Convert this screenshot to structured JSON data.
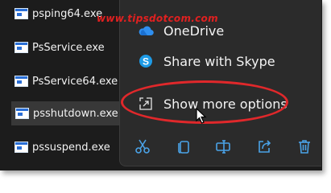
{
  "files": [
    {
      "name": "psping64.exe",
      "selected": false
    },
    {
      "name": "PsService.exe",
      "selected": false
    },
    {
      "name": "PsService64.exe",
      "selected": false
    },
    {
      "name": "psshutdown.exe",
      "selected": true
    },
    {
      "name": "pssuspend.exe",
      "selected": false
    }
  ],
  "watermark": "www.tipsdotcom.com",
  "menu": {
    "items": [
      {
        "label": "OneDrive",
        "icon": "onedrive-icon"
      },
      {
        "label": "Share with Skype",
        "icon": "skype-icon"
      },
      {
        "label": "Show more options",
        "icon": "show-more-options-icon"
      }
    ]
  },
  "toolbar": {
    "buttons": [
      {
        "icon": "cut-icon"
      },
      {
        "icon": "copy-icon"
      },
      {
        "icon": "rename-icon"
      },
      {
        "icon": "share-icon"
      },
      {
        "icon": "delete-icon"
      }
    ]
  },
  "colors": {
    "highlight_ellipse": "#e0282b",
    "accent": "#4aa3e8",
    "menu_background": "#2b2b2b",
    "explorer_background": "#1c1c1c"
  }
}
